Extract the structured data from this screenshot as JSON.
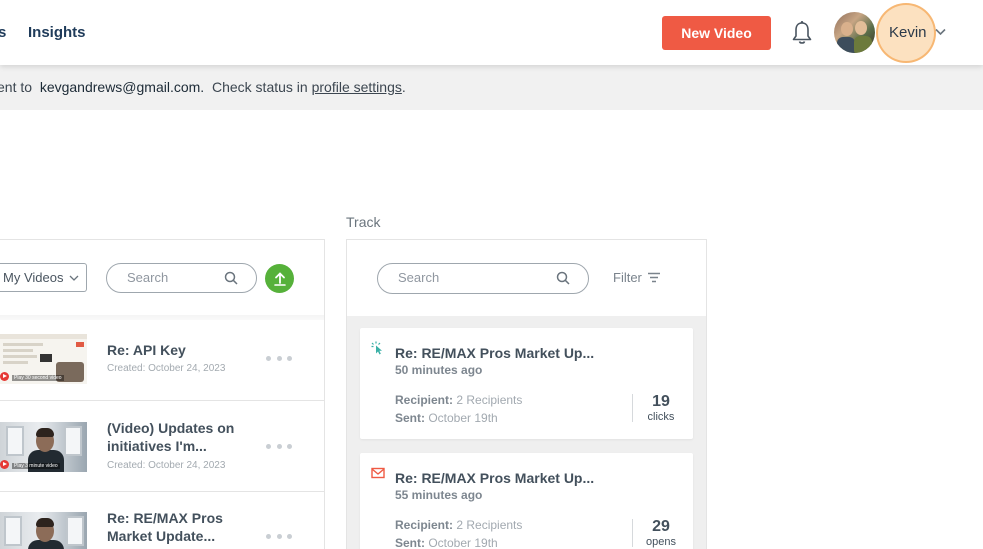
{
  "nav": {
    "partial_item": "s",
    "insights": "Insights",
    "new_video": "New Video",
    "user_name": "Kevin"
  },
  "notice": {
    "prefix": "ent to",
    "email": "kevgandrews@gmail.com.",
    "middle": "Check status in",
    "link": "profile settings",
    "suffix": "."
  },
  "library": {
    "filter_value": "My Videos",
    "search_placeholder": "Search",
    "videos": [
      {
        "title": "Re: API Key",
        "created": "Created: October 24, 2023",
        "thumb_label": "Play 30 second video"
      },
      {
        "title_line1": "(Video) Updates on",
        "title_line2": "initiatives I'm...",
        "created": "Created: October 24, 2023",
        "thumb_label": "Play 3 minute video"
      },
      {
        "title_line1": "Re: RE/MAX Pros",
        "title_line2": "Market Update..."
      }
    ]
  },
  "track": {
    "label": "Track",
    "search_placeholder": "Search",
    "filter_label": "Filter",
    "items": [
      {
        "icon": "cursor-click-icon",
        "title": "Re: RE/MAX Pros Market Up...",
        "ago": "50 minutes ago",
        "recipient_label": "Recipient:",
        "recipient_value": "2 Recipients",
        "sent_label": "Sent:",
        "sent_value": "October 19th",
        "count": "19",
        "unit": "clicks"
      },
      {
        "icon": "envelope-open-icon",
        "title": "Re: RE/MAX Pros Market Up...",
        "ago": "55 minutes ago",
        "recipient_label": "Recipient:",
        "recipient_value": "2 Recipients",
        "sent_label": "Sent:",
        "sent_value": "October 19th",
        "count": "29",
        "unit": "opens"
      }
    ]
  },
  "colors": {
    "accent": "#ef5a44",
    "upload": "#56b13a",
    "click_icon": "#3ab0a6",
    "open_icon": "#ef5a44"
  }
}
